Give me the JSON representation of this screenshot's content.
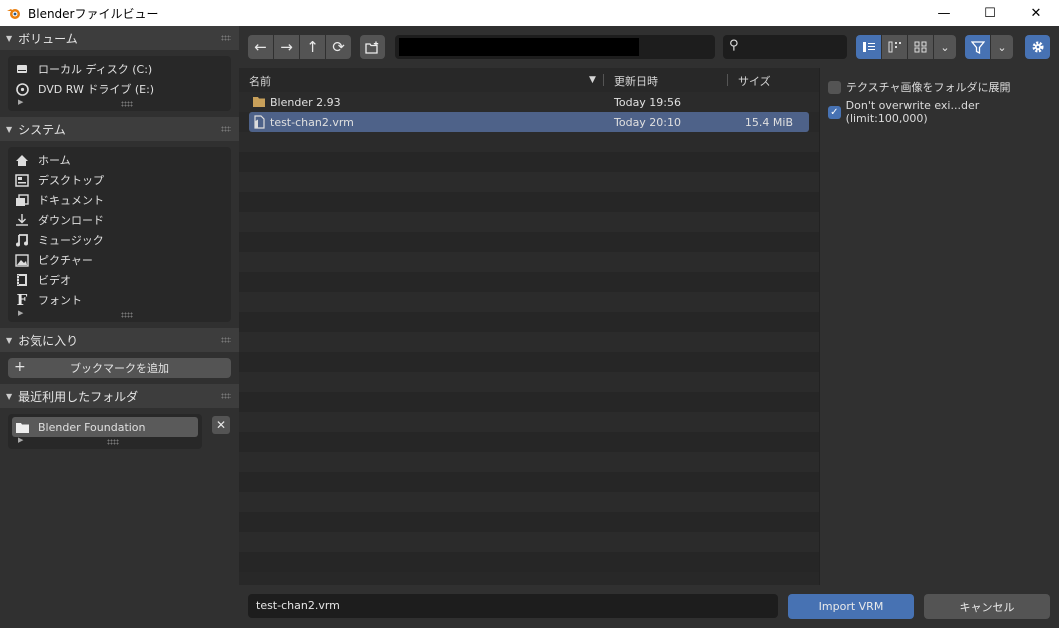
{
  "window": {
    "title": "Blenderファイルビュー",
    "minimize": "—",
    "maximize": "☐",
    "close": "✕"
  },
  "sidebar": {
    "volumes": {
      "title": "ボリューム",
      "items": [
        {
          "label": "ローカル ディスク (C:)",
          "icon": "hard-drive-icon"
        },
        {
          "label": "DVD RW ドライブ (E:)",
          "icon": "disc-icon"
        }
      ]
    },
    "system": {
      "title": "システム",
      "items": [
        {
          "label": "ホーム",
          "icon": "home-icon"
        },
        {
          "label": "デスクトップ",
          "icon": "desktop-icon"
        },
        {
          "label": "ドキュメント",
          "icon": "documents-icon"
        },
        {
          "label": "ダウンロード",
          "icon": "download-icon"
        },
        {
          "label": "ミュージック",
          "icon": "music-icon"
        },
        {
          "label": "ピクチャー",
          "icon": "picture-icon"
        },
        {
          "label": "ビデオ",
          "icon": "video-icon"
        },
        {
          "label": "フォント",
          "icon": "font-icon"
        }
      ]
    },
    "favorites": {
      "title": "お気に入り",
      "add_bookmark": "ブックマークを追加"
    },
    "recent": {
      "title": "最近利用したフォルダ",
      "items": [
        {
          "label": "Blender Foundation"
        }
      ],
      "remove": "✕"
    }
  },
  "toolbar": {
    "back": "←",
    "forward": "→",
    "parent": "↑",
    "refresh": "⟳",
    "path_value": "",
    "search_placeholder": ""
  },
  "filelist": {
    "columns": {
      "name": "名前",
      "date": "更新日時",
      "size": "サイズ",
      "sort_indicator": "▼"
    },
    "rows": [
      {
        "type": "folder",
        "name": "Blender 2.93",
        "date": "Today 19:56",
        "size": ""
      },
      {
        "type": "file",
        "name": "test-chan2.vrm",
        "date": "Today 20:10",
        "size": "15.4 MiB",
        "selected": true
      }
    ]
  },
  "options": {
    "extract_textures": {
      "label": "テクスチャ画像をフォルダに展開",
      "checked": false
    },
    "dont_overwrite": {
      "label": "Don't overwrite exi...der (limit:100,000)",
      "checked": true
    }
  },
  "bottom": {
    "filename": "test-chan2.vrm",
    "import_label": "Import VRM",
    "cancel_label": "キャンセル"
  },
  "colors": {
    "accent": "#4772b3",
    "selection": "#4e6289",
    "folder": "#c8a05a"
  }
}
